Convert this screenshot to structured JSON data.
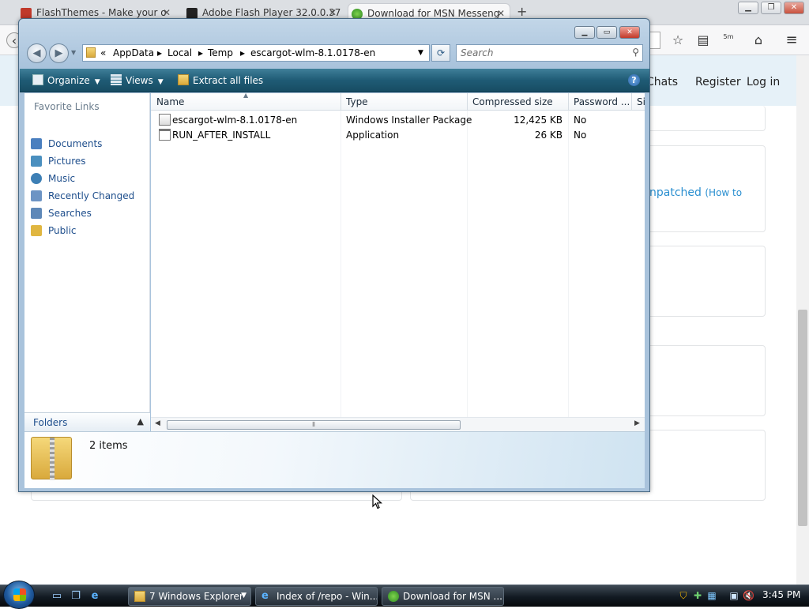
{
  "browser": {
    "tabs": [
      {
        "label": "FlashThemes - Make your o",
        "active": false
      },
      {
        "label": "Adobe Flash Player 32.0.0.37",
        "active": false
      },
      {
        "label": "Download for MSN Messeng",
        "active": true
      }
    ],
    "new_tab": "+",
    "nav_links": [
      "Chats",
      "Register",
      "Log in"
    ],
    "unpatched_text": "npatched",
    "how_to_text": "(How to",
    "badge": "5m"
  },
  "explorer": {
    "breadcrumb": [
      "AppData",
      "Local",
      "Temp",
      "escargot-wlm-8.1.0178-en"
    ],
    "breadcrumb_prefix": "«",
    "search_placeholder": "Search",
    "commands": {
      "organize": "Organize",
      "views": "Views",
      "extract": "Extract all files"
    },
    "favorite_links_header": "Favorite Links",
    "favorite_links": [
      {
        "label": "Documents",
        "color": "#4a7fbf"
      },
      {
        "label": "Pictures",
        "color": "#4a8fbf"
      },
      {
        "label": "Music",
        "color": "#3d7fb5"
      },
      {
        "label": "Recently Changed",
        "color": "#6d94c4"
      },
      {
        "label": "Searches",
        "color": "#5e88b8"
      },
      {
        "label": "Public",
        "color": "#e0b640"
      }
    ],
    "folders_label": "Folders",
    "columns": [
      "Name",
      "Type",
      "Compressed size",
      "Password ...",
      "Si"
    ],
    "files": [
      {
        "name": "escargot-wlm-8.1.0178-en",
        "type": "Windows Installer Package",
        "size": "12,425 KB",
        "password": "No"
      },
      {
        "name": "RUN_AFTER_INSTALL",
        "type": "Application",
        "size": "26 KB",
        "password": "No"
      }
    ],
    "item_count": "2 items"
  },
  "taskbar": {
    "buttons": [
      {
        "label": "7 Windows Explorer",
        "active": true
      },
      {
        "label": "Index of /repo - Win...",
        "active": false
      },
      {
        "label": "Download for MSN ...",
        "active": false
      }
    ],
    "clock": "3:45 PM"
  }
}
